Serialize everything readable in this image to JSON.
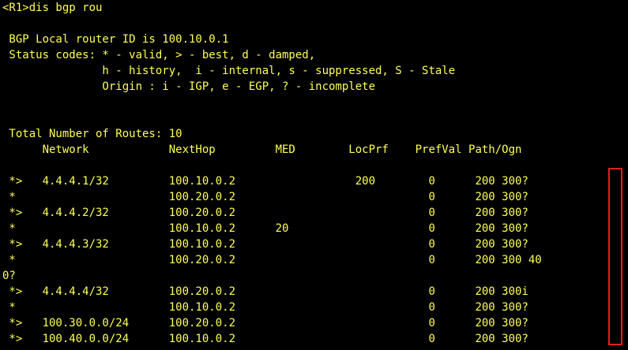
{
  "terminal": {
    "fg_color": "#ffff55",
    "bg_color": "#000000",
    "highlight_color": "#e02020",
    "lines": [
      "<R1>dis bgp rou",
      "",
      " BGP Local router ID is 100.10.0.1",
      " Status codes: * - valid, > - best, d - damped,",
      "               h - history,  i - internal, s - suppressed, S - Stale",
      "               Origin : i - IGP, e - EGP, ? - incomplete",
      "",
      "",
      " Total Number of Routes: 10",
      "      Network            NextHop         MED        LocPrf    PrefVal Path/Ogn",
      "",
      " *>   4.4.4.1/32         100.10.0.2                  200        0      200 300?",
      " *                       100.20.0.2                             0      200 300?",
      " *>   4.4.4.2/32         100.20.0.2                             0      200 300?",
      " *                       100.10.0.2      20                     0      200 300?",
      " *>   4.4.4.3/32         100.10.0.2                             0      200 300?",
      " *                       100.20.0.2                             0      200 300 40",
      "0?",
      " *>   4.4.4.4/32         100.20.0.2                             0      200 300i",
      " *                       100.10.0.2                             0      200 300?",
      " *>   100.30.0.0/24      100.20.0.2                             0      200 300?",
      " *>   100.40.0.0/24      100.10.0.2                             0      200 300?"
    ]
  }
}
